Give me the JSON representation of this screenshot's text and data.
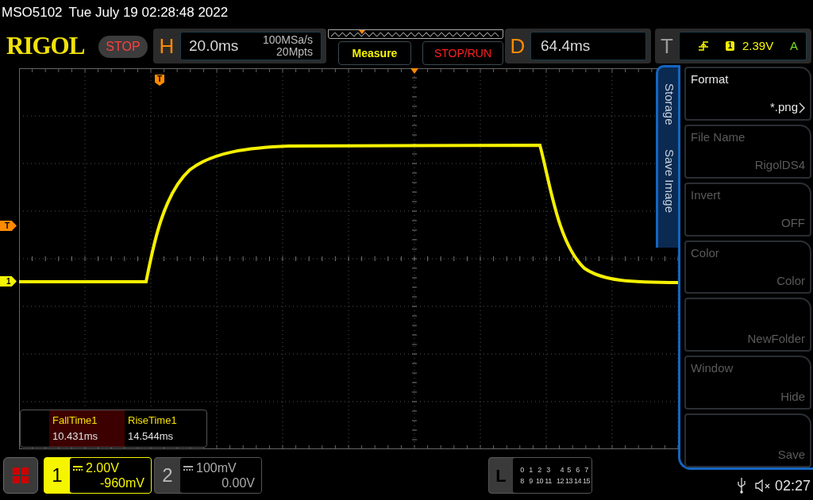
{
  "header": {
    "model": "MSO5102",
    "datetime": "Tue July 19 02:28:48 2022"
  },
  "toolbar": {
    "logo": "RIGOL",
    "run_state": "STOP",
    "horizontal": {
      "label": "H",
      "timebase": "20.0ms",
      "sample_rate": "100MSa/s",
      "memory_depth": "20Mpts"
    },
    "buttons": [
      {
        "label": "Measure",
        "kind": "measure"
      },
      {
        "label": "STOP/RUN",
        "kind": "run"
      }
    ],
    "delay": {
      "label": "D",
      "value": "64.4ms"
    },
    "trigger": {
      "label": "T",
      "channel": "1",
      "level": "2.39V",
      "mode": "A"
    }
  },
  "markers": {
    "trigger_position": "T",
    "trigger_level": "T",
    "channel": "1"
  },
  "measurements": [
    {
      "name": "FallTime1",
      "value": "10.431ms",
      "selected": true
    },
    {
      "name": "RiseTime1",
      "value": "14.544ms",
      "selected": false
    }
  ],
  "side_menu": {
    "tabs": [
      "Storage",
      "Save Image"
    ],
    "items": [
      {
        "title": "Format",
        "value": "*.png",
        "enabled": true,
        "submenu": true
      },
      {
        "title": "File Name",
        "value": "RigolDS4",
        "enabled": false,
        "submenu": false
      },
      {
        "title": "Invert",
        "value": "OFF",
        "enabled": false,
        "submenu": false
      },
      {
        "title": "Color",
        "value": "Color",
        "enabled": false,
        "submenu": false
      },
      {
        "value": "NewFolder",
        "enabled": false,
        "submenu": false
      },
      {
        "title": "Window",
        "value": "Hide",
        "enabled": false,
        "submenu": false
      },
      {
        "value": "Save",
        "enabled": false,
        "submenu": false
      }
    ]
  },
  "channels": [
    {
      "number": "1",
      "scale": "2.00V",
      "offset": "-960mV",
      "active": true
    },
    {
      "number": "2",
      "scale": "100mV",
      "offset": "0.00V",
      "active": false
    }
  ],
  "logic": {
    "label": "L",
    "rows": [
      [
        "0",
        "1",
        "2",
        "3",
        "4",
        "5",
        "6",
        "7"
      ],
      [
        "8",
        "9",
        "10",
        "11",
        "12",
        "13",
        "14",
        "15"
      ]
    ]
  },
  "status": {
    "time": "02:27"
  }
}
